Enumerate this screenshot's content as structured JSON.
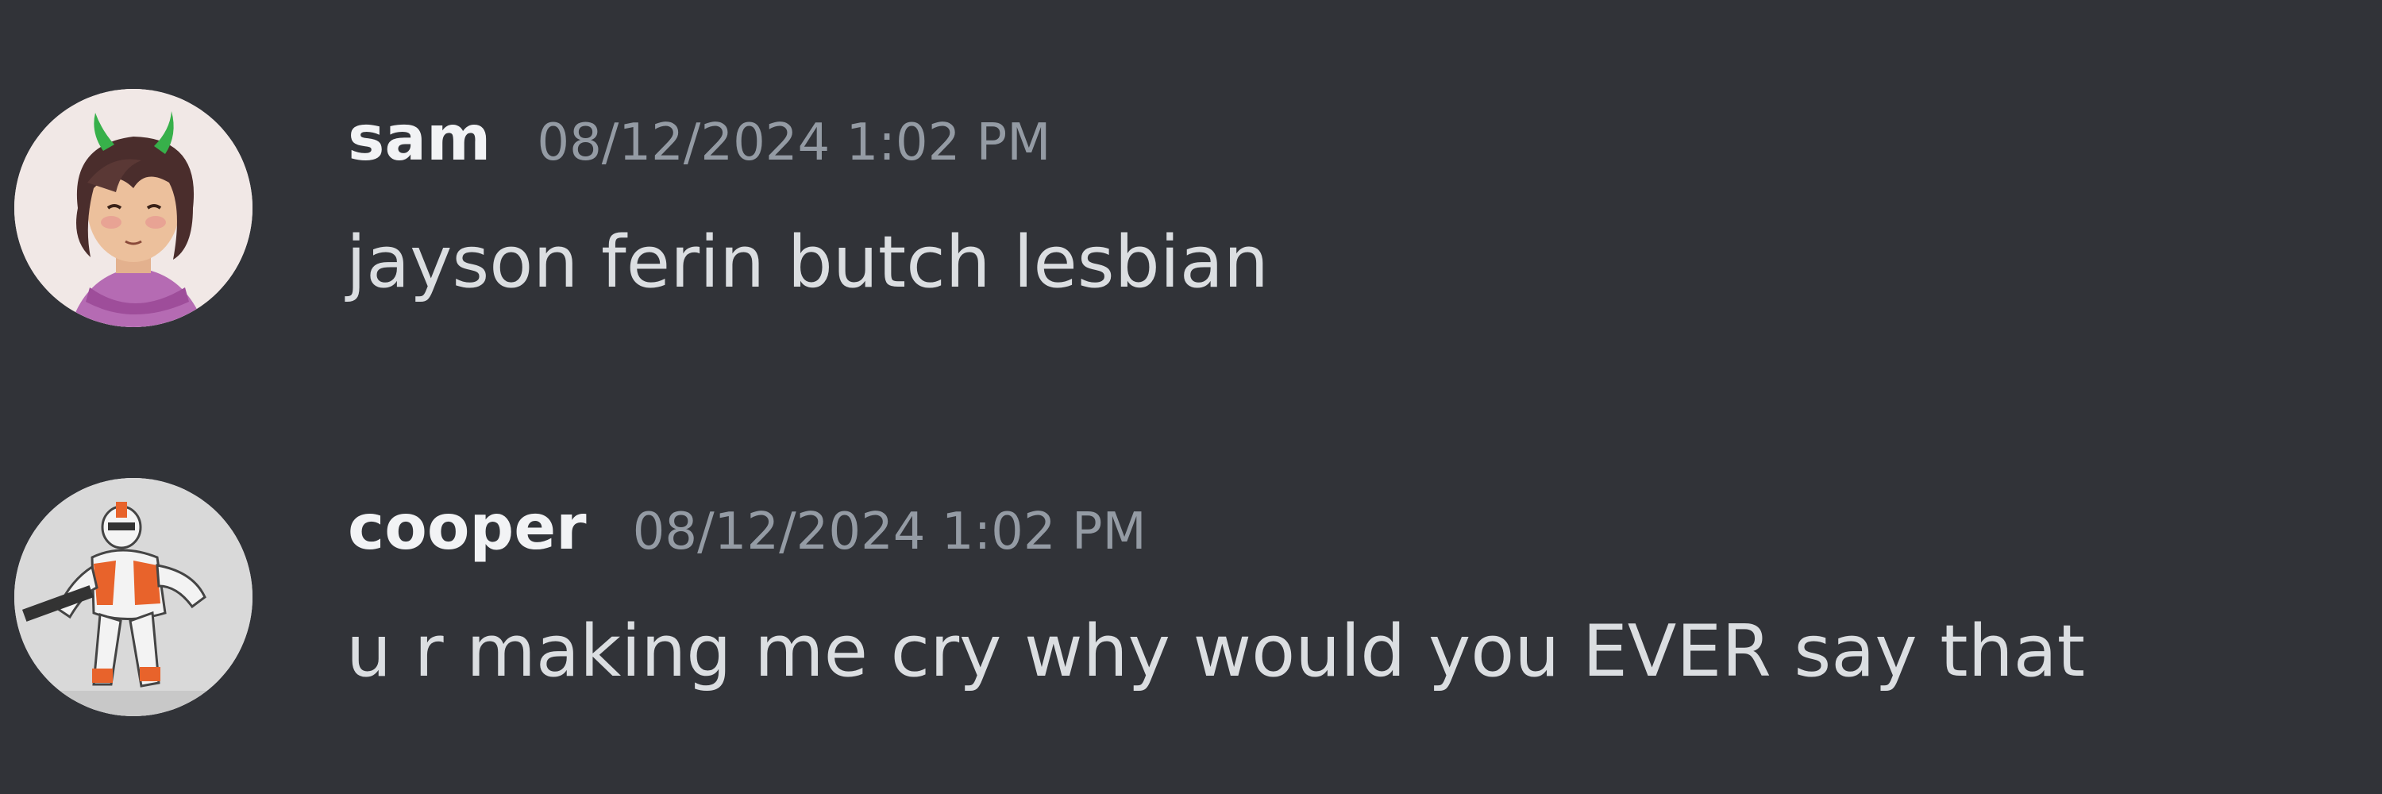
{
  "messages": [
    {
      "username": "sam",
      "timestamp": "08/12/2024 1:02 PM",
      "content": "jayson ferin butch lesbian",
      "avatar_icon": "sam-avatar-image"
    },
    {
      "username": "cooper",
      "timestamp": "08/12/2024 1:02 PM",
      "content": "u r making me cry why would you EVER say that",
      "avatar_icon": "cooper-avatar-image"
    }
  ],
  "colors": {
    "background": "#313338",
    "username": "#f2f3f5",
    "timestamp": "#949ba4",
    "message_text": "#dbdee1"
  }
}
